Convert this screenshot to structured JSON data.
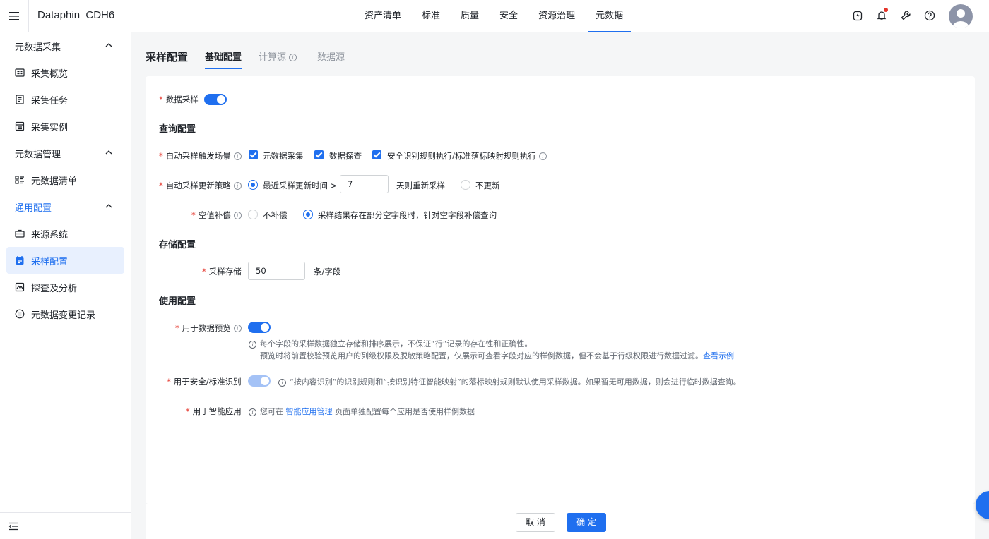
{
  "app": {
    "title": "Dataphin_CDH6"
  },
  "topnav": {
    "items": [
      {
        "label": "资产清单"
      },
      {
        "label": "标准"
      },
      {
        "label": "质量"
      },
      {
        "label": "安全"
      },
      {
        "label": "资源治理"
      },
      {
        "label": "元数据",
        "active": true
      }
    ],
    "icons": [
      "lightning-bolt-icon",
      "bell-icon",
      "wrench-icon",
      "help-icon"
    ],
    "notification_dot_color": "#e5352b"
  },
  "sidebar": {
    "groups": [
      {
        "label": "元数据采集",
        "items": [
          {
            "label": "采集概览",
            "icon": "overview-icon"
          },
          {
            "label": "采集任务",
            "icon": "task-icon"
          },
          {
            "label": "采集实例",
            "icon": "instance-icon"
          }
        ]
      },
      {
        "label": "元数据管理",
        "items": [
          {
            "label": "元数据清单",
            "icon": "list-icon"
          }
        ]
      },
      {
        "label": "通用配置",
        "items": [
          {
            "label": "来源系统",
            "icon": "briefcase-icon"
          },
          {
            "label": "采样配置",
            "icon": "sample-config-icon",
            "active": true
          },
          {
            "label": "探查及分析",
            "icon": "chart-icon"
          },
          {
            "label": "元数据变更记录",
            "icon": "change-log-icon"
          }
        ]
      }
    ]
  },
  "page": {
    "title": "采样配置",
    "tabs": [
      {
        "label": "基础配置",
        "active": true
      },
      {
        "label": "计算源"
      },
      {
        "label": "数据源"
      }
    ]
  },
  "form": {
    "data_sampling": {
      "label": "数据采样",
      "enabled": true
    },
    "query_section": "查询配置",
    "auto_trigger": {
      "label": "自动采样触发场景",
      "options": [
        {
          "label": "元数据采集",
          "checked": true
        },
        {
          "label": "数据探查",
          "checked": true
        },
        {
          "label": "安全识别规则执行/标准落标映射规则执行",
          "checked": true
        }
      ]
    },
    "update_strategy": {
      "label": "自动采样更新策略",
      "option1_label": "最近采样更新时间 >",
      "days_value": "7",
      "option1_suffix": "天则重新采样",
      "option2_label": "不更新",
      "selected": 1
    },
    "null_fill": {
      "label": "空值补偿",
      "option1_label": "不补偿",
      "option2_label": "采样结果存在部分空字段时，针对空字段补偿查询",
      "selected": 2
    },
    "storage_section": "存储配置",
    "sample_storage": {
      "label": "采样存储",
      "value": "50",
      "unit": "条/字段"
    },
    "usage_section": "使用配置",
    "preview": {
      "label": "用于数据预览",
      "enabled": true,
      "hint_line1": "每个字段的采样数据独立存储和排序展示，不保证“行”记录的存在性和正确性。",
      "hint_line2": "预览时将前置校验预览用户的列级权限及脱敏策略配置，仅展示可查看字段对应的样例数据，但不会基于行级权限进行数据过滤。",
      "hint_link": "查看示例"
    },
    "security_recognition": {
      "label": "用于安全/标准识别",
      "enabled": true,
      "disabled": true,
      "hint": "“按内容识别”的识别规则和“按识别特征智能映射”的落标映射规则默认使用采样数据。如果暂无可用数据，则会进行临时数据查询。"
    },
    "smart_app": {
      "label": "用于智能应用",
      "hint_prefix": "您可在",
      "hint_link": "智能应用管理",
      "hint_suffix": "页面单独配置每个应用是否使用样例数据"
    }
  },
  "footer": {
    "cancel_label": "取 消",
    "confirm_label": "确 定"
  },
  "colors": {
    "primary": "#1f6fef",
    "required": "#e5352b"
  }
}
